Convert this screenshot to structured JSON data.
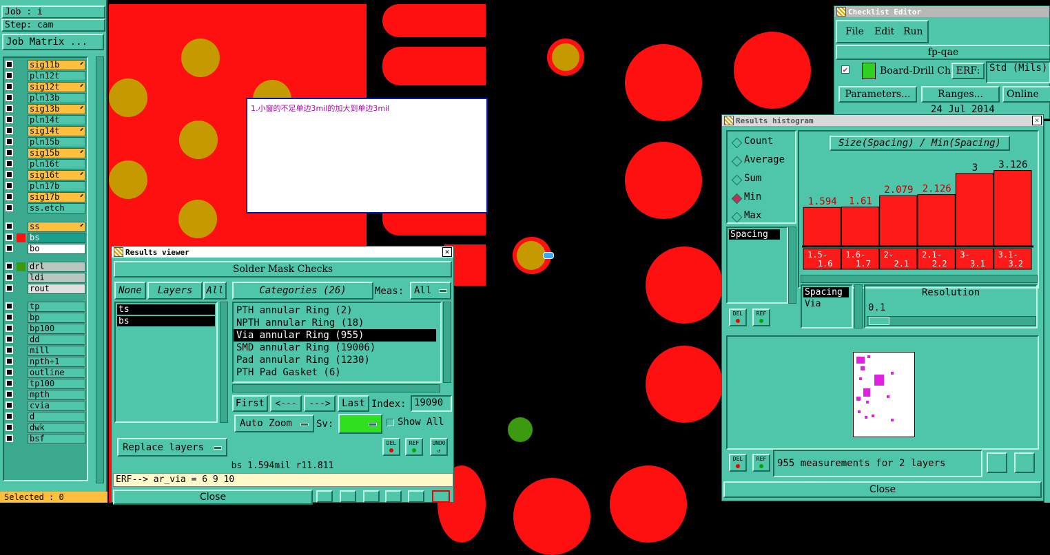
{
  "left_panel": {
    "job": "Job : i",
    "step": "Step: cam",
    "job_matrix_button": "Job Matrix ...",
    "layers": [
      {
        "name": "sig11b",
        "color": "#ffc040"
      },
      {
        "name": "pln12t",
        "color": "#4fc6aa"
      },
      {
        "name": "sig12t",
        "color": "#ffc040"
      },
      {
        "name": "pln13b",
        "color": "#4fc6aa"
      },
      {
        "name": "sig13b",
        "color": "#ffc040"
      },
      {
        "name": "pln14t",
        "color": "#4fc6aa"
      },
      {
        "name": "sig14t",
        "color": "#ffc040"
      },
      {
        "name": "pln15b",
        "color": "#4fc6aa"
      },
      {
        "name": "sig15b",
        "color": "#ffc040"
      },
      {
        "name": "pln16t",
        "color": "#4fc6aa"
      },
      {
        "name": "sig16t",
        "color": "#ffc040"
      },
      {
        "name": "pln17b",
        "color": "#4fc6aa"
      },
      {
        "name": "sig17b",
        "color": "#ffc040"
      },
      {
        "name": "ss.etch",
        "color": "#4fc6aa"
      }
    ],
    "mask_layers": [
      {
        "name": "ss",
        "color": "#ffc040"
      },
      {
        "name": "bs",
        "color": "#19a08a"
      },
      {
        "name": "bo",
        "color": "#ffffff"
      }
    ],
    "drill_layers": [
      {
        "name": "drl",
        "color": "#b8c8c0"
      },
      {
        "name": "ldi",
        "color": "#b8c8c0"
      },
      {
        "name": "rout",
        "color": "#e0e0e0"
      }
    ],
    "misc_layers": [
      "tp",
      "bp",
      "bp100",
      "dd",
      "mill",
      "npth+1",
      "outline",
      "tp100",
      "mpth",
      "cvia",
      "d",
      "dwk",
      "bsf"
    ],
    "selected": "Selected : 0"
  },
  "note_box": {
    "text": "1.小窗的不足单边3mil的加大到单边3mil"
  },
  "results_viewer": {
    "title": "Results viewer",
    "header": "Solder Mask Checks",
    "none_btn": "None",
    "layers_label": "Layers",
    "all_btn": "All",
    "categories_label": "Categories (26)",
    "meas_label": "Meas:",
    "meas_value": "All",
    "layer_list": [
      "ts",
      "bs"
    ],
    "categories": [
      "PTH annular Ring (2)",
      "NPTH annular Ring (18)",
      "Via annular Ring (955)",
      "SMD annular Ring (19006)",
      "Pad annular Ring (1230)",
      "PTH Pad Gasket (6)"
    ],
    "selected_category_index": 2,
    "first_btn": "First",
    "prev_btn": "<---",
    "next_btn": "--->",
    "last_btn": "Last",
    "index_label": "Index:",
    "index_value": "19090",
    "auto_zoom": "Auto Zoom",
    "sv_label": "Sv:",
    "show_all": "Show All",
    "replace_layers": "Replace layers",
    "del": "DEL",
    "ref": "REF",
    "undo": "UNDO",
    "status": "bs 1.594mil  r11.811",
    "erf_line": "ERF--> ar_via = 6 9 10",
    "close": "Close"
  },
  "checklist_editor": {
    "title": "Checklist Editor",
    "menu": [
      "File",
      "Edit",
      "Run"
    ],
    "name": "fp-qae",
    "check_name": "Board-Drill Che",
    "erf_label": "ERF:",
    "erf_value": "Std (Mils)",
    "parameters": "Parameters...",
    "ranges": "Ranges...",
    "online": "Online",
    "date": "24 Jul 2014"
  },
  "histogram": {
    "title": "Results histogram",
    "modes": [
      "Count",
      "Average",
      "Sum",
      "Min",
      "Max"
    ],
    "selected_mode": "Min",
    "chart_title": "Size(Spacing) / Min(Spacing)",
    "list": [
      "Spacing"
    ],
    "list2": [
      "Spacing",
      "Via"
    ],
    "resolution_label": "Resolution",
    "resolution_value": "0.1",
    "del": "DEL",
    "ref": "REF",
    "status": "955 measurements for 2 layers",
    "close": "Close"
  },
  "chart_data": {
    "type": "bar",
    "title": "Size(Spacing) / Min(Spacing)",
    "categories": [
      "1.5-\n1.6",
      "1.6-\n1.7",
      "2-\n2.1",
      "2.1-\n2.2",
      "3-\n3.1",
      "3.1-\n3.2"
    ],
    "values": [
      1.594,
      1.61,
      2.079,
      2.126,
      3,
      3.126
    ],
    "labels": [
      "1.594",
      "1.61",
      "2.079",
      "2.126",
      "3",
      "3.126"
    ],
    "ylim": [
      0,
      3.2
    ],
    "bar_color": "#ff1a1a",
    "label_color": "#c00000"
  }
}
